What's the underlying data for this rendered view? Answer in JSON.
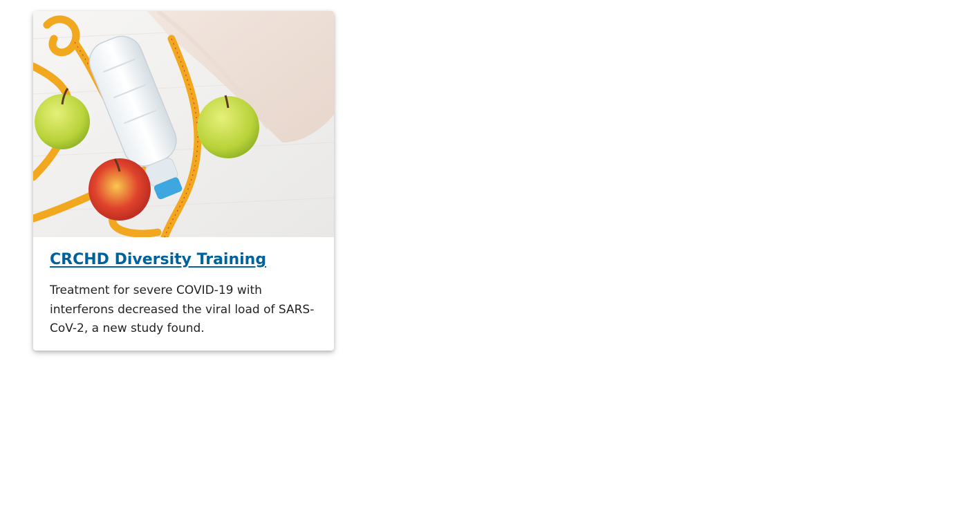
{
  "card": {
    "image": {
      "alt": "",
      "icon": "fitness-photo"
    },
    "title": "CRCHD Diversity Training",
    "summary": "Treatment for severe COVID-19 with interferons decreased the viral load of SARS-CoV-2, a new study found.",
    "colors": {
      "title_link": "#00629b",
      "summary_text": "#222222"
    }
  }
}
